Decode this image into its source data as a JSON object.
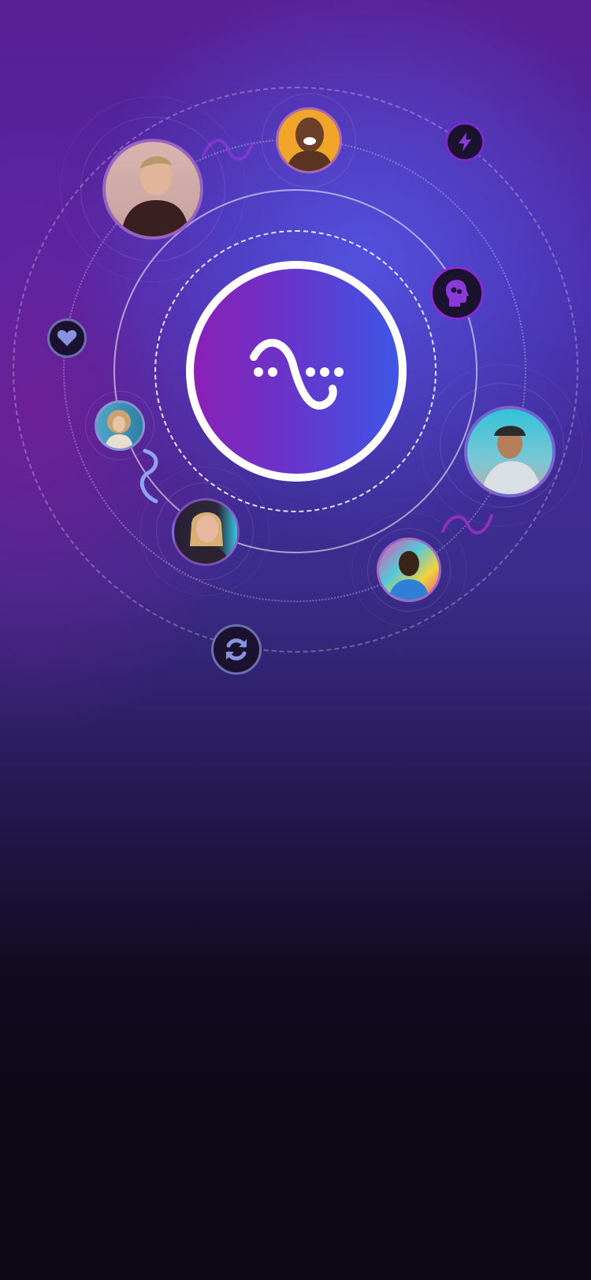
{
  "app": {
    "logo_name": "wave-logo-icon",
    "colors": {
      "accent_purple": "#8a21b5",
      "accent_blue": "#3d56e6",
      "background_dark": "#0c0816",
      "icon_lavender": "#8a93e0",
      "icon_violet": "#8a3ad8"
    }
  },
  "orbit": {
    "avatars": [
      {
        "name": "person-young-man-sweater"
      },
      {
        "name": "person-smiling-woman-orange"
      },
      {
        "name": "person-man-cap"
      },
      {
        "name": "person-man-colorful-wall"
      },
      {
        "name": "person-woman-blonde-smiling"
      },
      {
        "name": "person-woman-curly-hair"
      }
    ],
    "icons": [
      {
        "name": "lightning-icon"
      },
      {
        "name": "brain-head-icon"
      },
      {
        "name": "heart-icon"
      },
      {
        "name": "refresh-icon"
      }
    ]
  }
}
